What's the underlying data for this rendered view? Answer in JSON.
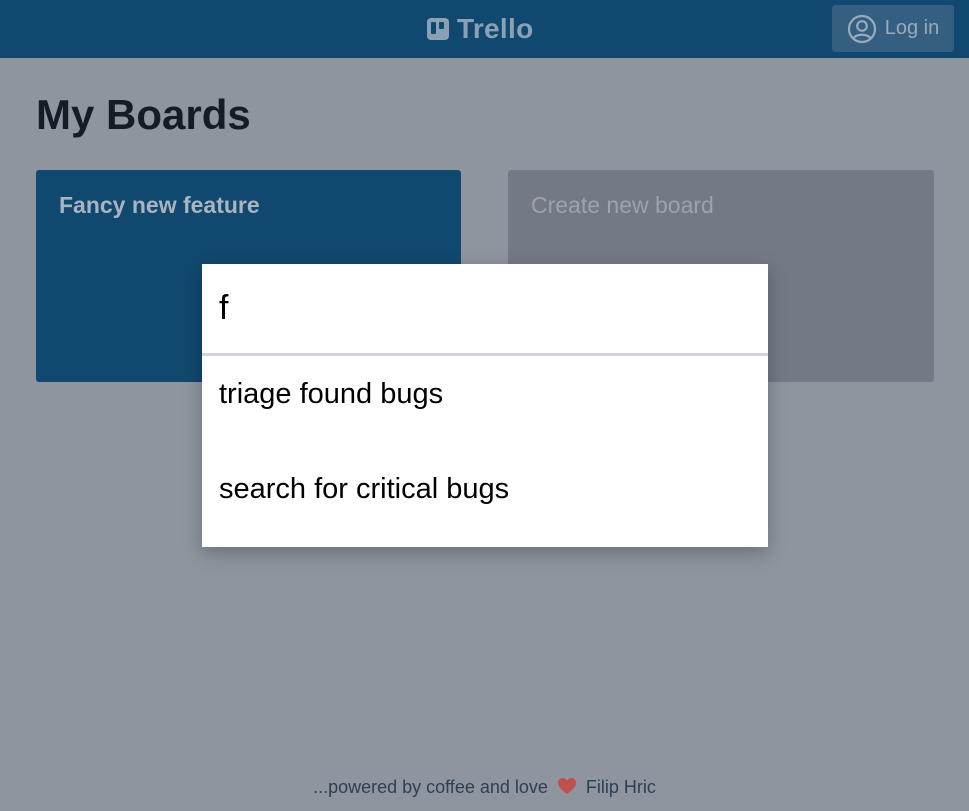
{
  "header": {
    "logo_text": "Trello",
    "login_label": "Log in"
  },
  "main": {
    "title": "My Boards",
    "boards": [
      {
        "title": "Fancy new feature"
      }
    ],
    "create_board_label": "Create new board"
  },
  "search": {
    "query": "f",
    "results": [
      {
        "label": "triage found bugs"
      },
      {
        "label": "search for critical bugs"
      }
    ]
  },
  "footer": {
    "prefix": "...powered by coffee and love",
    "author": "Filip Hric"
  },
  "colors": {
    "topbar": "#11486f",
    "overlay_background": "#8e959f",
    "board_card": "#11486f",
    "create_card": "#737a86",
    "heart": "#c0504d"
  },
  "icons": {
    "logo": "trello-logo-icon",
    "login": "user-circle-icon",
    "footer": "heart-icon"
  }
}
